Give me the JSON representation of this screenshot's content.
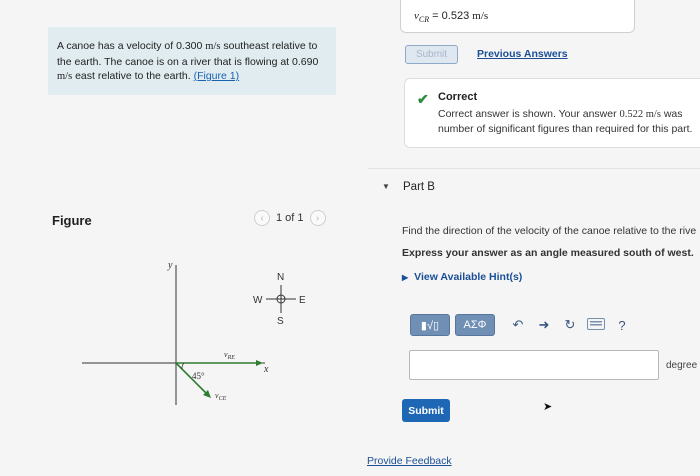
{
  "problem": {
    "line1": "A canoe has a velocity of 0.300",
    "line1_unit": "m/s",
    "line1_tail": " southeast relative to",
    "line2": "the earth. The canoe is on a river that is flowing at 0.690",
    "line3_unit": "m/s",
    "line3_tail": " east relative to the earth. ",
    "figure_link": "(Figure 1)"
  },
  "figure": {
    "title": "Figure",
    "pager_text": "1 of 1",
    "prev_icon": "chevron-left-icon",
    "next_icon": "chevron-right-icon",
    "compass": {
      "n": "N",
      "s": "S",
      "e": "E",
      "w": "W"
    },
    "axis_x": "x",
    "axis_y": "y",
    "vector_re": "v",
    "vector_re_sub": "RE",
    "vector_ce": "v",
    "vector_ce_sub": "CE",
    "angle_label": "45°"
  },
  "part_a": {
    "answer_var": "v",
    "answer_sub": "CR",
    "answer_value": " = 0.523",
    "answer_unit": "m/s",
    "submit_label": "Submit",
    "previous_answers": "Previous Answers",
    "feedback_title": "Correct",
    "feedback_line1_a": "Correct answer is shown. Your answer ",
    "feedback_line1_val": "0.522 m/s",
    "feedback_line1_b": " was",
    "feedback_line2": "number of significant figures than required for this part."
  },
  "part_b": {
    "label": "Part B",
    "question": "Find the direction of the velocity of the canoe relative to the rive",
    "instruction": "Express your answer as an angle measured south of west.",
    "hint": "View Available Hint(s)",
    "toolbar": {
      "templates_label": "▮√▯",
      "greek_label": "ΑΣΦ",
      "undo_icon": "undo-icon",
      "redo_icon": "redo-icon",
      "reset_icon": "reset-icon",
      "keyboard_icon": "keyboard-icon",
      "help_label": "?"
    },
    "input_value": "",
    "unit": "degree",
    "submit_label": "Submit",
    "provide_feedback": "Provide Feedback"
  }
}
